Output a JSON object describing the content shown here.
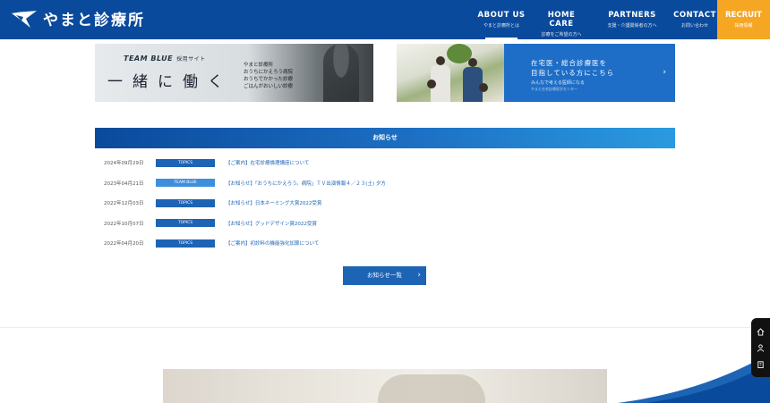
{
  "header": {
    "logo_text": "やまと診療所",
    "nav": [
      {
        "en": "ABOUT US",
        "jp": "やまと診療所とは"
      },
      {
        "en": "HOME CARE",
        "jp": "診療をご希望の方へ"
      },
      {
        "en": "PARTNERS",
        "jp": "支援・介護関係者の方へ"
      },
      {
        "en": "CONTACT",
        "jp": "お問い合わせ"
      }
    ],
    "recruit": {
      "en": "RECRUIT",
      "jp": "採用情報"
    }
  },
  "banners": {
    "left": {
      "team": "TEAM BLUE",
      "team_sub": "採用サイト",
      "big": "一緒に働く",
      "copy": [
        "やまと診療所",
        "おうちにかえろう病院",
        "おうちでかかった診療",
        "ごはんがおいしい診療"
      ]
    },
    "right": {
      "title_1": "在宅医・総合診療医を",
      "title_2": "目指している方にこちら",
      "sub_1": "みんなで考える医師になる",
      "sub_2": "やまと在宅診療医学センター",
      "arrow": "›"
    }
  },
  "news": {
    "heading": "お知らせ",
    "items": [
      {
        "date": "2024年09月29日",
        "tag": "TOPICS",
        "title": "【ご案内】在宅診療倫理講座について"
      },
      {
        "date": "2023年04月21日",
        "tag": "TEAM BLUE",
        "title": "【お知らせ】「おうちにかえろう。病院」ＴＶ出演情報４／２３(土) 夕方"
      },
      {
        "date": "2022年12月03日",
        "tag": "TOPICS",
        "title": "【お知らせ】日本ネーミング大賞2022受賞"
      },
      {
        "date": "2022年10月07日",
        "tag": "TOPICS",
        "title": "【お知らせ】グッドデザイン賞2022受賞"
      },
      {
        "date": "2022年04月20日",
        "tag": "TOPICS",
        "title": "【ご案内】初診料の機能強化加算について"
      }
    ],
    "more_label": "お知らせ一覧",
    "more_chevron": "›"
  }
}
